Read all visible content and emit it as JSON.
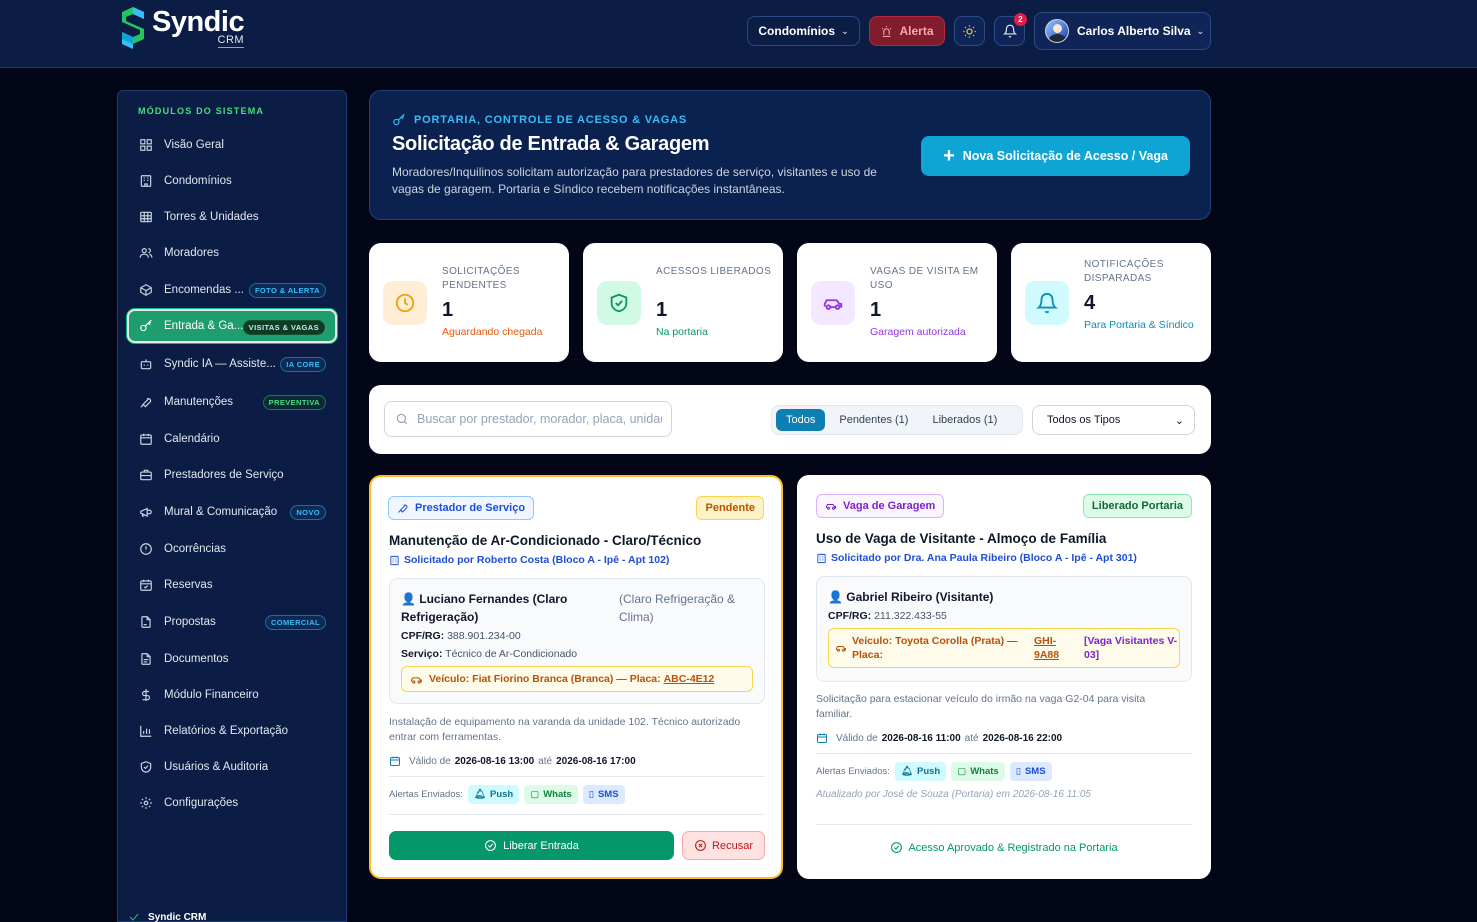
{
  "brand": {
    "name": "Syndic",
    "sub": "CRM"
  },
  "header": {
    "condominios_label": "Condomínios",
    "alerta_label": "Alerta",
    "notif_count": "2",
    "user_name": "Carlos Alberto Silva"
  },
  "sidebar": {
    "section_title": "MÓDULOS DO SISTEMA",
    "items": [
      {
        "label": "Visão Geral",
        "icon": "grid-icon"
      },
      {
        "label": "Condomínios",
        "icon": "building-icon"
      },
      {
        "label": "Torres & Unidades",
        "icon": "table-icon"
      },
      {
        "label": "Moradores",
        "icon": "users-icon"
      },
      {
        "label": "Encomendas ...",
        "icon": "package-icon",
        "tag": "FOTO & ALERTA"
      },
      {
        "label": "Entrada & Ga...",
        "icon": "key-icon",
        "tag": "VISITAS & VAGAS",
        "active": true
      },
      {
        "label": "Syndic IA — Assiste...",
        "icon": "bot-icon",
        "tag": "IA CORE"
      },
      {
        "label": "Manutenções",
        "icon": "wrench-icon",
        "tag": "PREVENTIVA"
      },
      {
        "label": "Calendário",
        "icon": "calendar-icon"
      },
      {
        "label": "Prestadores de Serviço",
        "icon": "briefcase-icon"
      },
      {
        "label": "Mural & Comunicação",
        "icon": "megaphone-icon",
        "tag": "NOVO"
      },
      {
        "label": "Ocorrências",
        "icon": "alert-circle-icon"
      },
      {
        "label": "Reservas",
        "icon": "calendar-check-icon"
      },
      {
        "label": "Propostas",
        "icon": "file-signature-icon",
        "tag": "COMERCIAL"
      },
      {
        "label": "Documentos",
        "icon": "file-icon"
      },
      {
        "label": "Módulo Financeiro",
        "icon": "dollar-icon"
      },
      {
        "label": "Relatórios & Exportação",
        "icon": "bar-chart-icon"
      },
      {
        "label": "Usuários & Auditoria",
        "icon": "shield-icon"
      },
      {
        "label": "Configurações",
        "icon": "gear-icon"
      }
    ],
    "footer": "Syndic CRM"
  },
  "hero": {
    "kicker": "PORTARIA, CONTROLE DE ACESSO & VAGAS",
    "title": "Solicitação de Entrada & Garagem",
    "description": "Moradores/Inquilinos solicitam autorização para prestadores de serviço, visitantes e uso de vagas de garagem. Portaria e Síndico recebem notificações instantâneas.",
    "button": "Nova Solicitação de Acesso / Vaga"
  },
  "stats": [
    {
      "label": "SOLICITAÇÕES PENDENTES",
      "value": "1",
      "sub": "Aguardando chegada",
      "color": "#ea580c",
      "icon": "clock-icon"
    },
    {
      "label": "ACESSOS LIBERADOS",
      "value": "1",
      "sub": "Na portaria",
      "color": "#059669",
      "icon": "shield-check-icon"
    },
    {
      "label": "VAGAS DE VISITA EM USO",
      "value": "1",
      "sub": "Garagem autorizada",
      "color": "#9333ea",
      "icon": "car-icon"
    },
    {
      "label": "NOTIFICAÇÕES DISPARADAS",
      "value": "4",
      "sub": "Para Portaria & Síndico",
      "color": "#0891b2",
      "icon": "bell-icon"
    }
  ],
  "filter": {
    "search_placeholder": "Buscar por prestador, morador, placa, unidade...",
    "tabs": [
      "Todos",
      "Pendentes (1)",
      "Liberados (1)"
    ],
    "active_tab": "Todos",
    "type_select": "Todos os Tipos"
  },
  "cards": [
    {
      "category": "Prestador de Serviço",
      "status": "Pendente",
      "title": "Manutenção de Ar-Condicionado - Claro/Técnico",
      "requested_by": "Solicitado por Roberto Costa (Bloco A - Ipê - Apt 102)",
      "person": "👤 Luciano Fernandes (Claro Refrigeração)",
      "company": "(Claro Refrigeração & Clima)",
      "doc_label": "CPF/RG:",
      "doc": "388.901.234-00",
      "service_label": "Serviço:",
      "service": "Técnico de Ar-Condicionado",
      "vehicle": "Veículo: Fiat Fiorino Branca (Branca) — Placa:",
      "plate": "ABC-4E12",
      "description": "Instalação de equipamento na varanda da unidade 102. Técnico autorizado entrar com ferramentas.",
      "valid_prefix": "Válido de",
      "valid_from": "2026-08-16 13:00",
      "valid_mid": "até",
      "valid_to": "2026-08-16 17:00",
      "alerts_label": "Alertas Enviados:",
      "alerts": [
        "Push",
        "Whats",
        "SMS"
      ],
      "approve_button": "Liberar Entrada",
      "reject_button": "Recusar"
    },
    {
      "category": "Vaga de Garagem",
      "status": "Liberado Portaria",
      "title": "Uso de Vaga de Visitante - Almoço de Família",
      "requested_by": "Solicitado por Dra. Ana Paula Ribeiro (Bloco A - Ipê - Apt 301)",
      "person": "👤 Gabriel Ribeiro (Visitante)",
      "doc_label": "CPF/RG:",
      "doc": "211.322.433-55",
      "vehicle": "Veículo: Toyota Corolla (Prata) — Placa:",
      "plate": "GHI-9A88",
      "spot": "[Vaga Visitantes V-03]",
      "description": "Solicitação para estacionar veículo do irmão na vaga G2-04 para visita familiar.",
      "valid_prefix": "Válido de",
      "valid_from": "2026-08-16 11:00",
      "valid_mid": "até",
      "valid_to": "2026-08-16 22:00",
      "alerts_label": "Alertas Enviados:",
      "alerts": [
        "Push",
        "Whats",
        "SMS"
      ],
      "updated": "Atualizado por José de Souza (Portaria) em 2026-08-16 11:05",
      "approved_text": "Acesso Aprovado & Registrado na Portaria"
    }
  ]
}
